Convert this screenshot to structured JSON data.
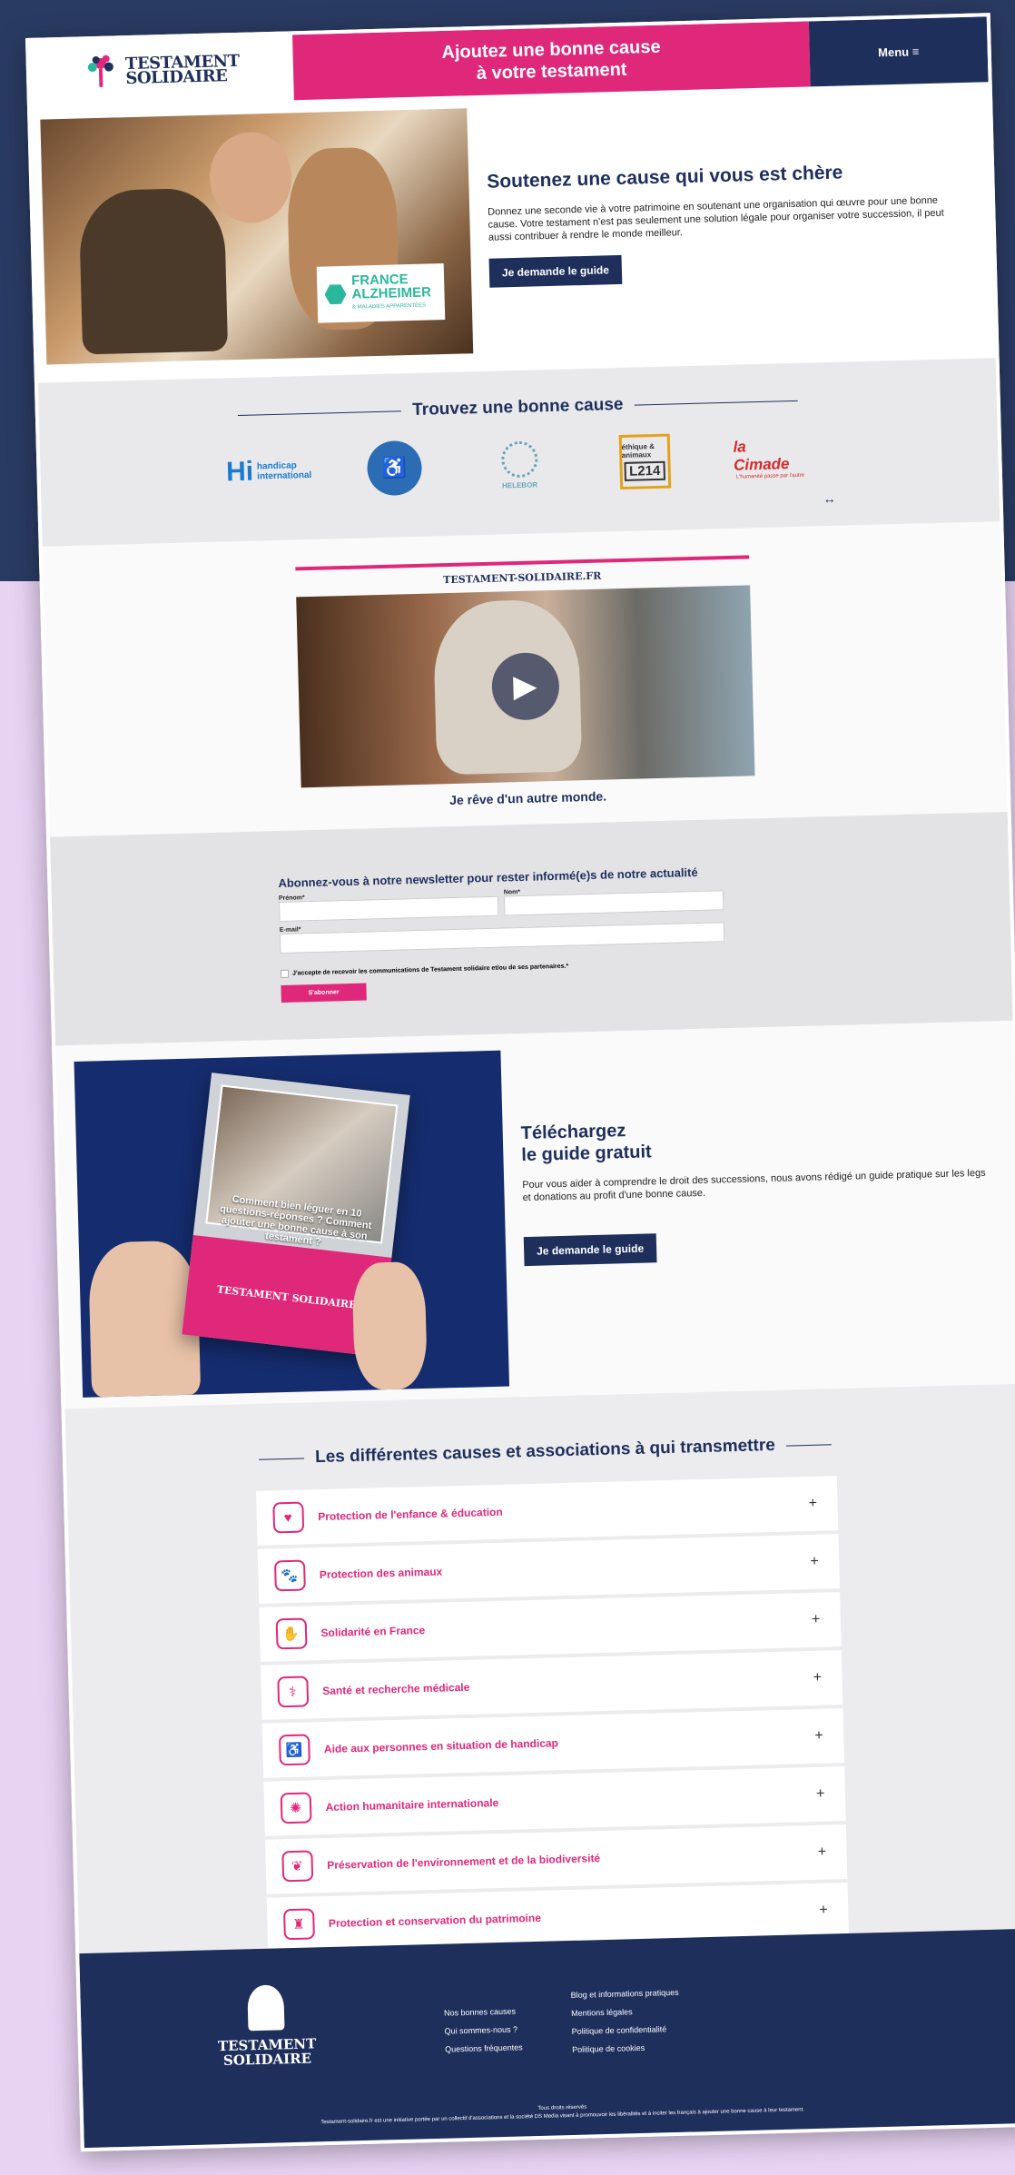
{
  "header": {
    "logo_line1": "TESTAMENT",
    "logo_line2": "SOLIDAIRE",
    "banner_line1": "Ajoutez une bonne cause",
    "banner_line2": "à votre testament",
    "menu_label": "Menu ≡"
  },
  "hero": {
    "badge_line1": "FRANCE",
    "badge_line2": "ALZHEIMER",
    "badge_sub": "& MALADIES APPARENTÉES",
    "title": "Soutenez une cause qui vous est chère",
    "text": "Donnez une seconde vie à votre patrimoine en soutenant une organisation qui œuvre pour une bonne cause. Votre testament n'est pas seulement une solution légale pour organiser votre succession, il peut aussi contribuer à rendre le monde meilleur.",
    "button": "Je demande le guide"
  },
  "find": {
    "title": "Trouvez une bonne cause",
    "logos": {
      "hi_mark": "Hi",
      "hi_text": "handicap international",
      "helebor": "HELEBOR",
      "l214_top": "éthique & animaux",
      "l214": "L214",
      "cimade": "la Cimade",
      "cimade_sub": "L'humanité passe par l'autre"
    },
    "arrows": "↔"
  },
  "video": {
    "header": "TESTAMENT-SOLIDAIRE.FR",
    "caption": "Je rêve d'un autre monde."
  },
  "newsletter": {
    "title": "Abonnez-vous à notre newsletter pour rester informé(e)s de notre actualité",
    "prenom_label": "Prénom*",
    "nom_label": "Nom*",
    "email_label": "E-mail*",
    "consent": "J'accepte de recevoir les communications de Testament solidaire et/ou de ses partenaires.*",
    "button": "S'abonner"
  },
  "guide": {
    "book_question": "Comment bien léguer en 10 questions-réponses ? Comment ajouter une bonne cause à son testament ?",
    "book_brand": "TESTAMENT SOLIDAIRE",
    "title_line1": "Téléchargez",
    "title_line2": "le guide gratuit",
    "text": "Pour vous aider à comprendre le droit des successions, nous avons rédigé un guide pratique sur les legs et donations au profit d'une bonne cause.",
    "button": "Je demande le guide"
  },
  "causes": {
    "title": "Les différentes causes et associations à qui transmettre",
    "items": [
      {
        "label": "Protection de l'enfance & éducation",
        "icon": "♥"
      },
      {
        "label": "Protection des animaux",
        "icon": "🐾"
      },
      {
        "label": "Solidarité en France",
        "icon": "✋"
      },
      {
        "label": "Santé et recherche médicale",
        "icon": "⚕"
      },
      {
        "label": "Aide aux personnes en situation de handicap",
        "icon": "♿"
      },
      {
        "label": "Action humanitaire internationale",
        "icon": "✺"
      },
      {
        "label": "Préservation de l'environnement et de la biodiversité",
        "icon": "❦"
      },
      {
        "label": "Protection et conservation du patrimoine",
        "icon": "♜"
      }
    ],
    "plus": "+"
  },
  "footer": {
    "logo_line1": "TESTAMENT",
    "logo_line2": "SOLIDAIRE",
    "col1": [
      "Nos bonnes causes",
      "Qui sommes-nous ?",
      "Questions fréquentes"
    ],
    "col2": [
      "Blog et informations pratiques",
      "Mentions légales",
      "Politique de confidentialité",
      "Politique de cookies"
    ],
    "rights": "Tous droits réservés",
    "copy": "Testament-solidaire.fr est une initiative portée par un collectif d'associations et la société DS Media visant à promouvoir les libéralités et à inciter les français à ajouter une bonne cause à leur testament."
  }
}
